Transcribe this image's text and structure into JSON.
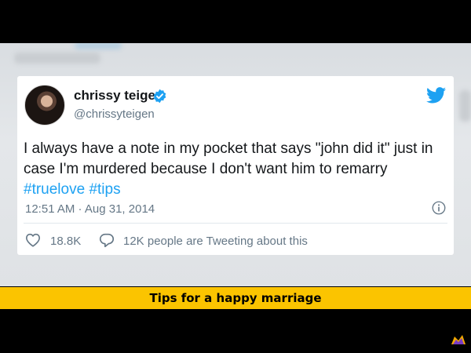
{
  "tweet": {
    "user_name": "chrissy teigen",
    "user_handle": "@chrissyteigen",
    "text_part1": "I always have a note in my pocket that says \"john did it\" just in case I'm murdered because I don't want him to remarry",
    "hashtag1": "#truelove",
    "hashtag2": "#tips",
    "timestamp": "12:51 AM · Aug 31, 2014",
    "like_count": "18.8K",
    "reply_text": "12K people are Tweeting about this",
    "icons": {
      "verified": "verified-badge-icon",
      "brand": "twitter-bird-icon",
      "info": "info-icon",
      "like": "heart-icon",
      "reply": "speech-bubble-icon"
    }
  },
  "caption": {
    "text": "Tips for a happy marriage"
  },
  "colors": {
    "link_blue": "#1da1f2",
    "secondary_text": "#657786",
    "caption_bg": "#fbc400"
  }
}
